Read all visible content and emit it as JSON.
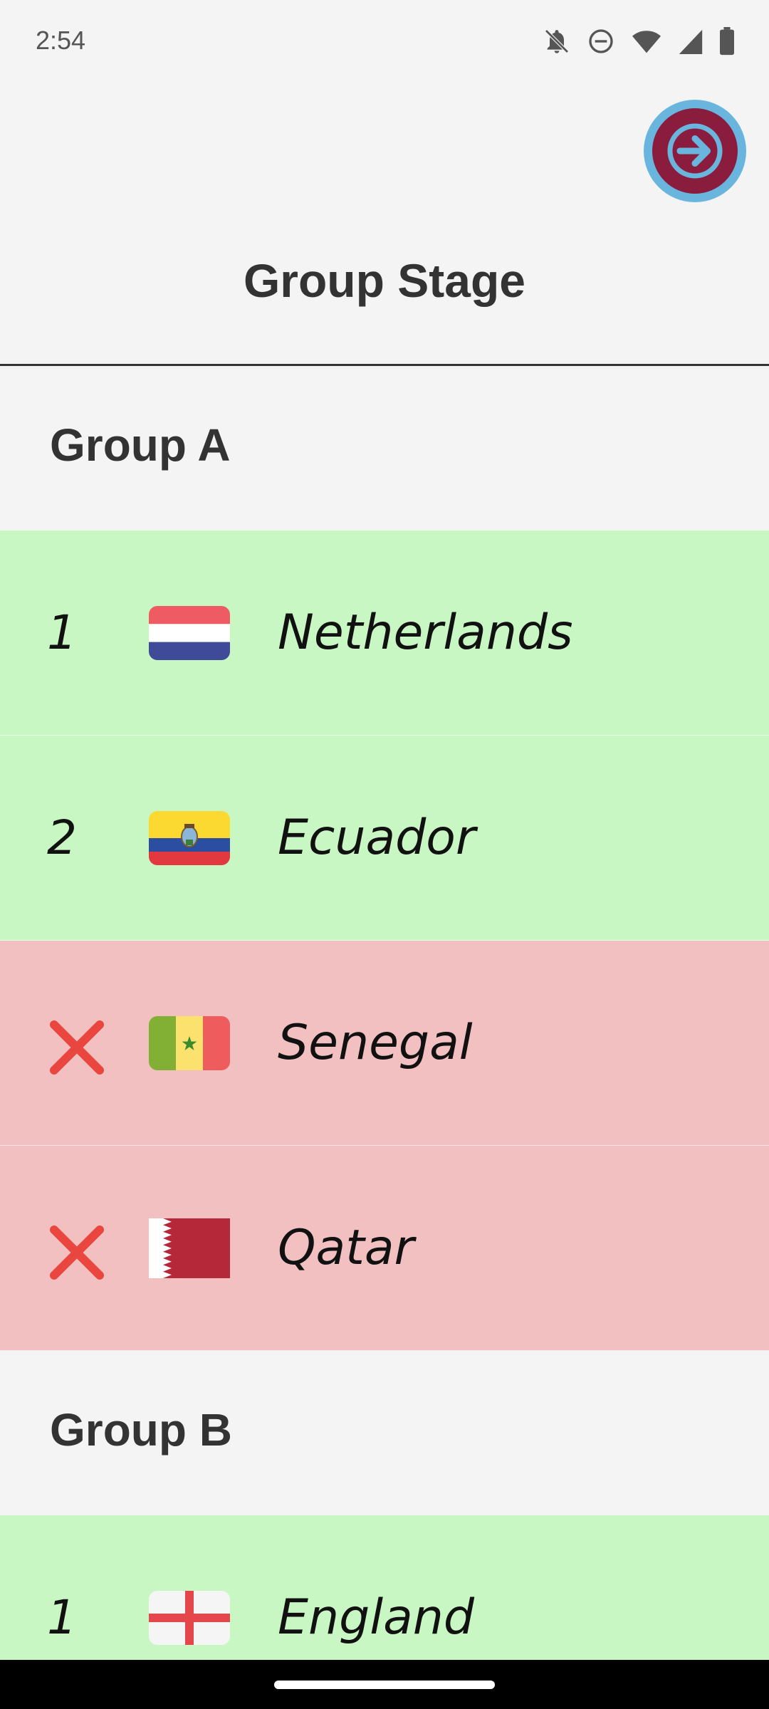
{
  "status_bar": {
    "time": "2:54",
    "icons": [
      "notifications-off-icon",
      "do-not-disturb-icon",
      "wifi-icon",
      "cell-signal-icon",
      "battery-icon"
    ]
  },
  "header": {
    "title": "Group Stage",
    "next_button_icon": "arrow-right-icon"
  },
  "colors": {
    "advanced_row": "#c9f7c3",
    "eliminated_row": "#f2c0c0",
    "next_button_fill": "#8a1c3e",
    "next_button_ring": "#6ab5de"
  },
  "groups": [
    {
      "name": "Group A",
      "teams": [
        {
          "rank": "1",
          "status": "advanced",
          "name": "Netherlands",
          "flag_icon": "netherlands-flag-icon"
        },
        {
          "rank": "2",
          "status": "advanced",
          "name": "Ecuador",
          "flag_icon": "ecuador-flag-icon"
        },
        {
          "rank": "",
          "status": "eliminated",
          "name": "Senegal",
          "flag_icon": "senegal-flag-icon"
        },
        {
          "rank": "",
          "status": "eliminated",
          "name": "Qatar",
          "flag_icon": "qatar-flag-icon"
        }
      ]
    },
    {
      "name": "Group B",
      "teams": [
        {
          "rank": "1",
          "status": "advanced",
          "name": "England",
          "flag_icon": "england-flag-icon"
        }
      ]
    }
  ]
}
